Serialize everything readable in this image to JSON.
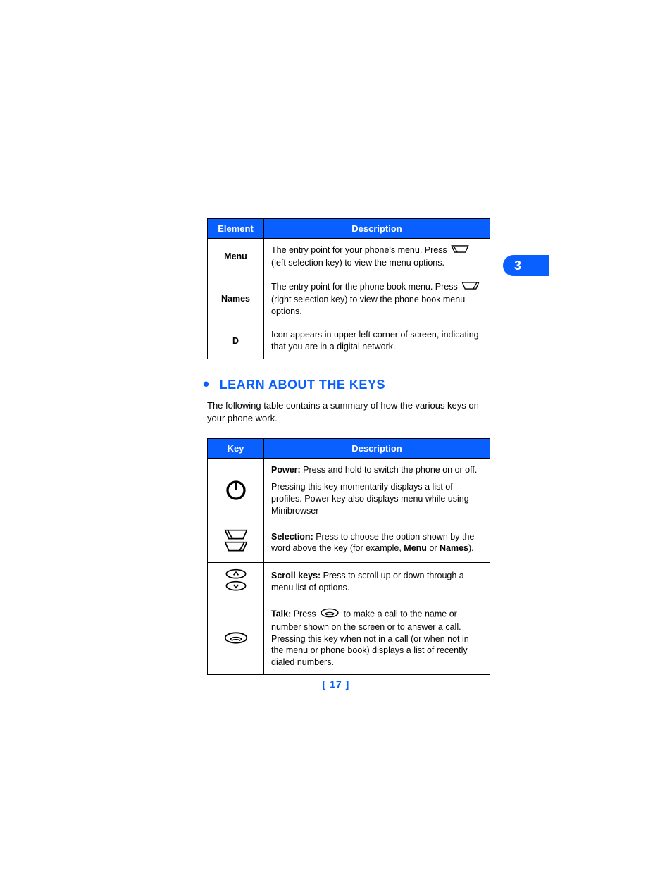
{
  "section_tab": "3",
  "page_number": "[ 17 ]",
  "table1": {
    "headers": {
      "element": "Element",
      "description": "Description"
    },
    "rows": [
      {
        "element": "Menu",
        "desc_pre": "The entry point for your phone's menu. Press ",
        "desc_post": " (left selection key) to view the menu options."
      },
      {
        "element": "Names",
        "desc_pre": "The entry point for the phone book menu. Press ",
        "desc_post": " (right selection key) to view the phone book menu options."
      },
      {
        "element_icon": "D",
        "desc": "Icon appears in upper left corner of screen, indicating that you are in a digital network."
      }
    ]
  },
  "heading": "LEARN ABOUT THE KEYS",
  "intro": "The following table contains a summary of how the various keys on your phone work.",
  "table2": {
    "headers": {
      "key": "Key",
      "description": "Description"
    },
    "rows": [
      {
        "desc_b": "Power:",
        "desc_a": " Press and hold to switch the phone on or off.",
        "desc_p2": "Pressing this key momentarily displays a list of profiles. Power key also displays menu while using Minibrowser"
      },
      {
        "desc_b": "Selection:",
        "desc_a_pre": " Press to choose the option shown by the word above the key (for example, ",
        "desc_a_b1": "Menu",
        "desc_a_mid": " or ",
        "desc_a_b2": "Names",
        "desc_a_post": ")."
      },
      {
        "desc_b": "Scroll keys:",
        "desc_a": " Press to scroll up or down through a menu list of options."
      },
      {
        "desc_b": "Talk:",
        "desc_a_pre": " Press ",
        "desc_a_post": " to make a call to the name or number shown on the screen or to answer a call. Pressing this key when not in a call (or when not in the menu or phone book) displays a list of recently dialed numbers."
      }
    ]
  }
}
